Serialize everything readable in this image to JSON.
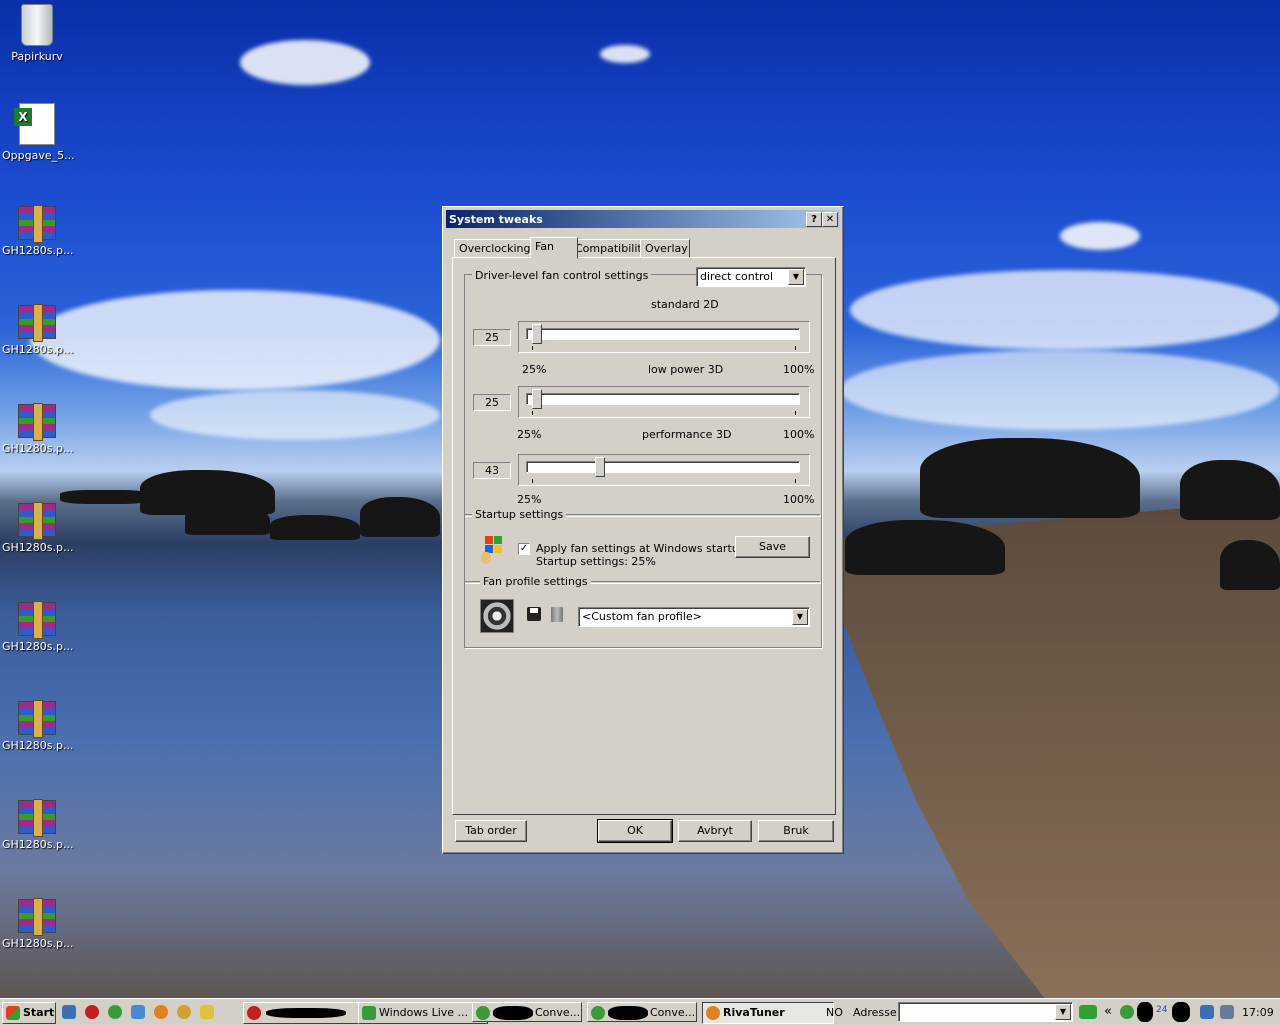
{
  "desktop": {
    "icons": [
      {
        "label": "Papirkurv",
        "type": "bin"
      },
      {
        "label": "Oppgave_5...",
        "type": "xls"
      },
      {
        "label": "GH1280s.p...",
        "type": "rar"
      },
      {
        "label": "GH1280s.p...",
        "type": "rar"
      },
      {
        "label": "GH1280s.p...",
        "type": "rar"
      },
      {
        "label": "GH1280s.p...",
        "type": "rar"
      },
      {
        "label": "GH1280s.p...",
        "type": "rar"
      },
      {
        "label": "GH1280s.p...",
        "type": "rar"
      },
      {
        "label": "GH1280s.p...",
        "type": "rar"
      },
      {
        "label": "GH1280s.p...",
        "type": "rar"
      }
    ]
  },
  "dialog": {
    "title": "System tweaks",
    "help_btn": "?",
    "close_btn": "✕",
    "tabs": [
      "Overclocking",
      "Fan",
      "Compatibility",
      "Overlay"
    ],
    "active_tab": "Fan",
    "driver_group": {
      "label": "Driver-level fan control settings",
      "mode": "direct control"
    },
    "sliders": [
      {
        "title": "standard 2D",
        "value": "25",
        "level": 0,
        "min": "25%",
        "max": "100%"
      },
      {
        "title": "low power 3D",
        "value": "25",
        "level": 0,
        "min": "25%",
        "max": "100%"
      },
      {
        "title": "performance 3D",
        "value": "43",
        "level": 0.24,
        "min": "25%",
        "max": "100%"
      }
    ],
    "startup": {
      "label": "Startup settings",
      "checkbox_label": "Apply fan settings at Windows startup",
      "checked": true,
      "status": "Startup settings:  25%",
      "save": "Save"
    },
    "profile": {
      "label": "Fan profile settings",
      "selected": "<Custom fan profile>"
    },
    "buttons": {
      "tab_order": "Tab order",
      "ok": "OK",
      "cancel": "Avbryt",
      "apply": "Bruk"
    }
  },
  "taskbar": {
    "start": "Start",
    "items": [
      {
        "label": "",
        "active": false
      },
      {
        "label": "Windows Live ...",
        "active": false
      },
      {
        "label": "Conve...",
        "active": false
      },
      {
        "label": "Conve...",
        "active": false
      },
      {
        "label": "RivaTuner",
        "active": true
      }
    ],
    "lang": "NO",
    "address_label": "Adresse",
    "address_value": "",
    "chevron": "«",
    "tray_number": "24",
    "clock": "17:09"
  }
}
